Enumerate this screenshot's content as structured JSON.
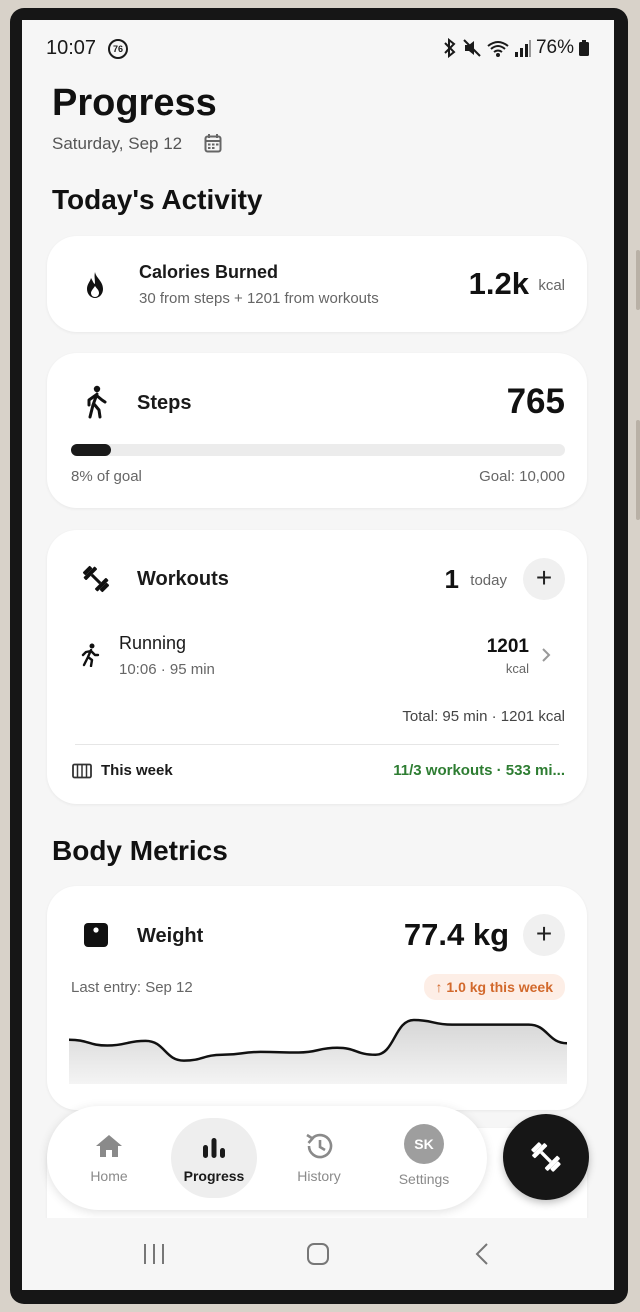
{
  "status_bar": {
    "time": "10:07",
    "notification_badge": "76",
    "battery": "76%"
  },
  "header": {
    "title": "Progress",
    "date": "Saturday, Sep 12"
  },
  "activity": {
    "section_title": "Today's Activity",
    "calories": {
      "title": "Calories Burned",
      "subtitle": "30 from steps + 1201 from workouts",
      "value": "1.2k",
      "unit": "kcal"
    },
    "steps": {
      "title": "Steps",
      "value": "765",
      "progress_fraction": 0.08,
      "progress_label": "8% of goal",
      "goal_label": "Goal: 10,000"
    },
    "workouts": {
      "title": "Workouts",
      "count": "1",
      "count_label": "today",
      "entry": {
        "name": "Running",
        "details": "10:06 · 95 min",
        "calories": "1201",
        "unit": "kcal"
      },
      "total": "Total: 95 min · 1201 kcal",
      "week_label": "This week",
      "week_summary": "11/3 workouts · 533 mi..."
    }
  },
  "body_metrics": {
    "section_title": "Body Metrics",
    "weight": {
      "title": "Weight",
      "value": "77.4 kg",
      "last_entry": "Last entry: Sep 12",
      "change_badge": "↑ 1.0 kg this week",
      "trend": [
        0.66,
        0.56,
        0.64,
        0.3,
        0.4,
        0.45,
        0.44,
        0.52,
        0.4,
        1.0,
        0.92,
        0.92,
        0.92,
        0.6
      ]
    }
  },
  "bottom_nav": {
    "items": [
      {
        "label": "Home"
      },
      {
        "label": "Progress"
      },
      {
        "label": "History"
      },
      {
        "label": "Settings",
        "avatar": "SK"
      }
    ]
  },
  "colors": {
    "accent_green": "#2e7d32",
    "badge_orange": "#d2692c",
    "dark": "#161616"
  }
}
